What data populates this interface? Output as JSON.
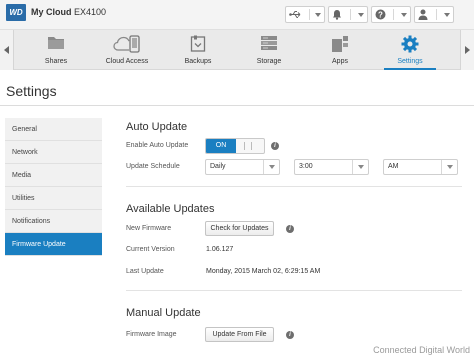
{
  "header": {
    "logo_text": "WD",
    "brand_bold": "My Cloud",
    "brand_model": "EX4100",
    "icons": [
      "usb-icon",
      "alert-bell-icon",
      "help-icon",
      "user-icon"
    ]
  },
  "nav": {
    "tabs": [
      {
        "label": "Shares",
        "icon": "shares-icon"
      },
      {
        "label": "Cloud Access",
        "icon": "cloud-access-icon"
      },
      {
        "label": "Backups",
        "icon": "backups-icon"
      },
      {
        "label": "Storage",
        "icon": "storage-icon"
      },
      {
        "label": "Apps",
        "icon": "apps-icon"
      },
      {
        "label": "Settings",
        "icon": "gear-icon",
        "active": true
      }
    ]
  },
  "page": {
    "title": "Settings"
  },
  "sidebar": {
    "items": [
      {
        "label": "General"
      },
      {
        "label": "Network"
      },
      {
        "label": "Media"
      },
      {
        "label": "Utilities"
      },
      {
        "label": "Notifications"
      },
      {
        "label": "Firmware Update",
        "active": true
      }
    ]
  },
  "auto_update": {
    "title": "Auto Update",
    "enable_label": "Enable Auto Update",
    "toggle_on": "ON",
    "schedule_label": "Update Schedule",
    "frequency": "Daily",
    "time": "3:00",
    "ampm": "AM"
  },
  "available_updates": {
    "title": "Available Updates",
    "new_firmware_label": "New Firmware",
    "check_button": "Check for Updates",
    "current_version_label": "Current Version",
    "current_version": "1.06.127",
    "last_update_label": "Last Update",
    "last_update": "Monday, 2015 March 02, 6:29:15 AM"
  },
  "manual_update": {
    "title": "Manual Update",
    "firmware_image_label": "Firmware Image",
    "upload_button": "Update From File"
  },
  "watermark": "Connected Digital World",
  "colors": {
    "accent": "#1a7fc1",
    "sidebar_bg": "#f1f1f1"
  }
}
